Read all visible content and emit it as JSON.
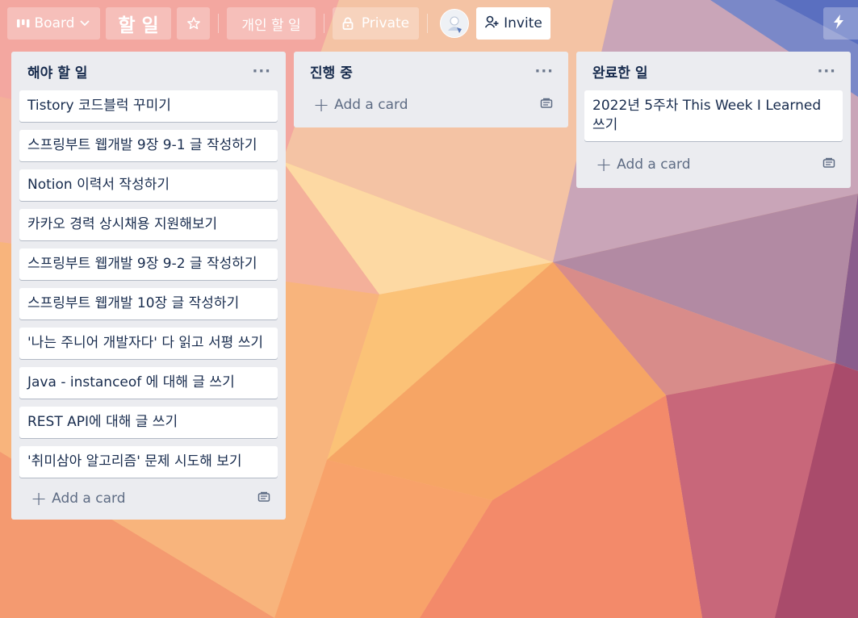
{
  "header": {
    "board_view_label": "Board",
    "board_title": "할 일",
    "workspace_label": "개인 할 일",
    "visibility_label": "Private",
    "invite_label": "Invite"
  },
  "lists": [
    {
      "title": "해야 할 일",
      "menu": "···",
      "cards": [
        "Tistory 코드블럭 꾸미기",
        "스프링부트 웹개발 9장 9-1 글 작성하기",
        "Notion 이력서 작성하기",
        "카카오 경력 상시채용 지원해보기",
        "스프링부트 웹개발 9장 9-2 글 작성하기",
        "스프링부트 웹개발 10장 글 작성하기",
        "'나는 주니어 개발자다' 다 읽고 서평 쓰기",
        "Java - instanceof 에 대해 글 쓰기",
        "REST API에 대해 글 쓰기",
        "'취미삼아 알고리즘' 문제 시도해 보기"
      ],
      "add_label": "Add a card"
    },
    {
      "title": "진행 중",
      "menu": "···",
      "cards": [],
      "add_label": "Add a card"
    },
    {
      "title": "완료한 일",
      "menu": "···",
      "cards": [
        "2022년 5주차 This Week I Learned 쓰기"
      ],
      "add_label": "Add a card"
    }
  ],
  "icons": {
    "board_view": "board-icon",
    "chevron": "chevron-down-icon",
    "star": "star-icon",
    "lock": "lock-icon",
    "invite": "add-person-icon",
    "power_ups": "lightning-icon",
    "template": "card-template-icon"
  },
  "colors": {
    "list_bg": "#ebecf0",
    "card_bg": "#ffffff",
    "text": "#172b4d",
    "muted": "#5e6c84"
  }
}
